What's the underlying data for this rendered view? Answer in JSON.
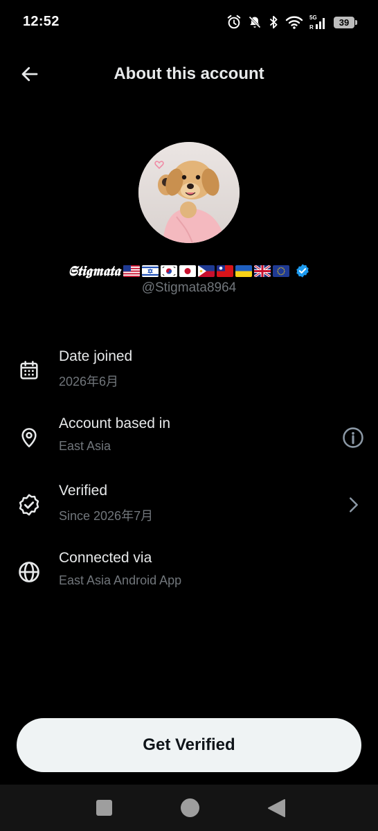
{
  "status_bar": {
    "time": "12:52",
    "network": "5G",
    "roaming": "R",
    "battery": "39",
    "icons": [
      "alarm-icon",
      "bell-off-icon",
      "bluetooth-icon",
      "wifi-icon",
      "signal-icon",
      "battery-icon"
    ]
  },
  "header": {
    "back_icon": "arrow-left-icon",
    "title": "About this account"
  },
  "profile": {
    "display_name": "𝕾𝖙𝖎𝖌𝖒𝖆𝖙𝖆",
    "flags": [
      "US",
      "IL",
      "KR",
      "JP",
      "PH",
      "TW",
      "UA",
      "GB",
      "EU"
    ],
    "handle": "@Stigmata8964",
    "verified": true,
    "verified_color": "#1d9bf0"
  },
  "rows": [
    {
      "icon": "calendar-icon",
      "title": "Date joined",
      "subtitle": "2026年6月"
    },
    {
      "icon": "location-pin-icon",
      "title": "Account based in",
      "subtitle": "East Asia",
      "action": "info-icon"
    },
    {
      "icon": "verified-badge-icon",
      "title": "Verified",
      "subtitle": "Since 2026年7月",
      "action": "chevron-right-icon"
    },
    {
      "icon": "globe-icon",
      "title": "Connected via",
      "subtitle": "East Asia Android App"
    }
  ],
  "cta": {
    "label": "Get Verified"
  },
  "nav_bar": {
    "buttons": [
      "recents-button",
      "home-button",
      "back-button"
    ]
  },
  "colors": {
    "background": "#000000",
    "primary_text": "#e7e9ea",
    "secondary_text": "#71767b",
    "button_bg": "#eff3f4"
  }
}
